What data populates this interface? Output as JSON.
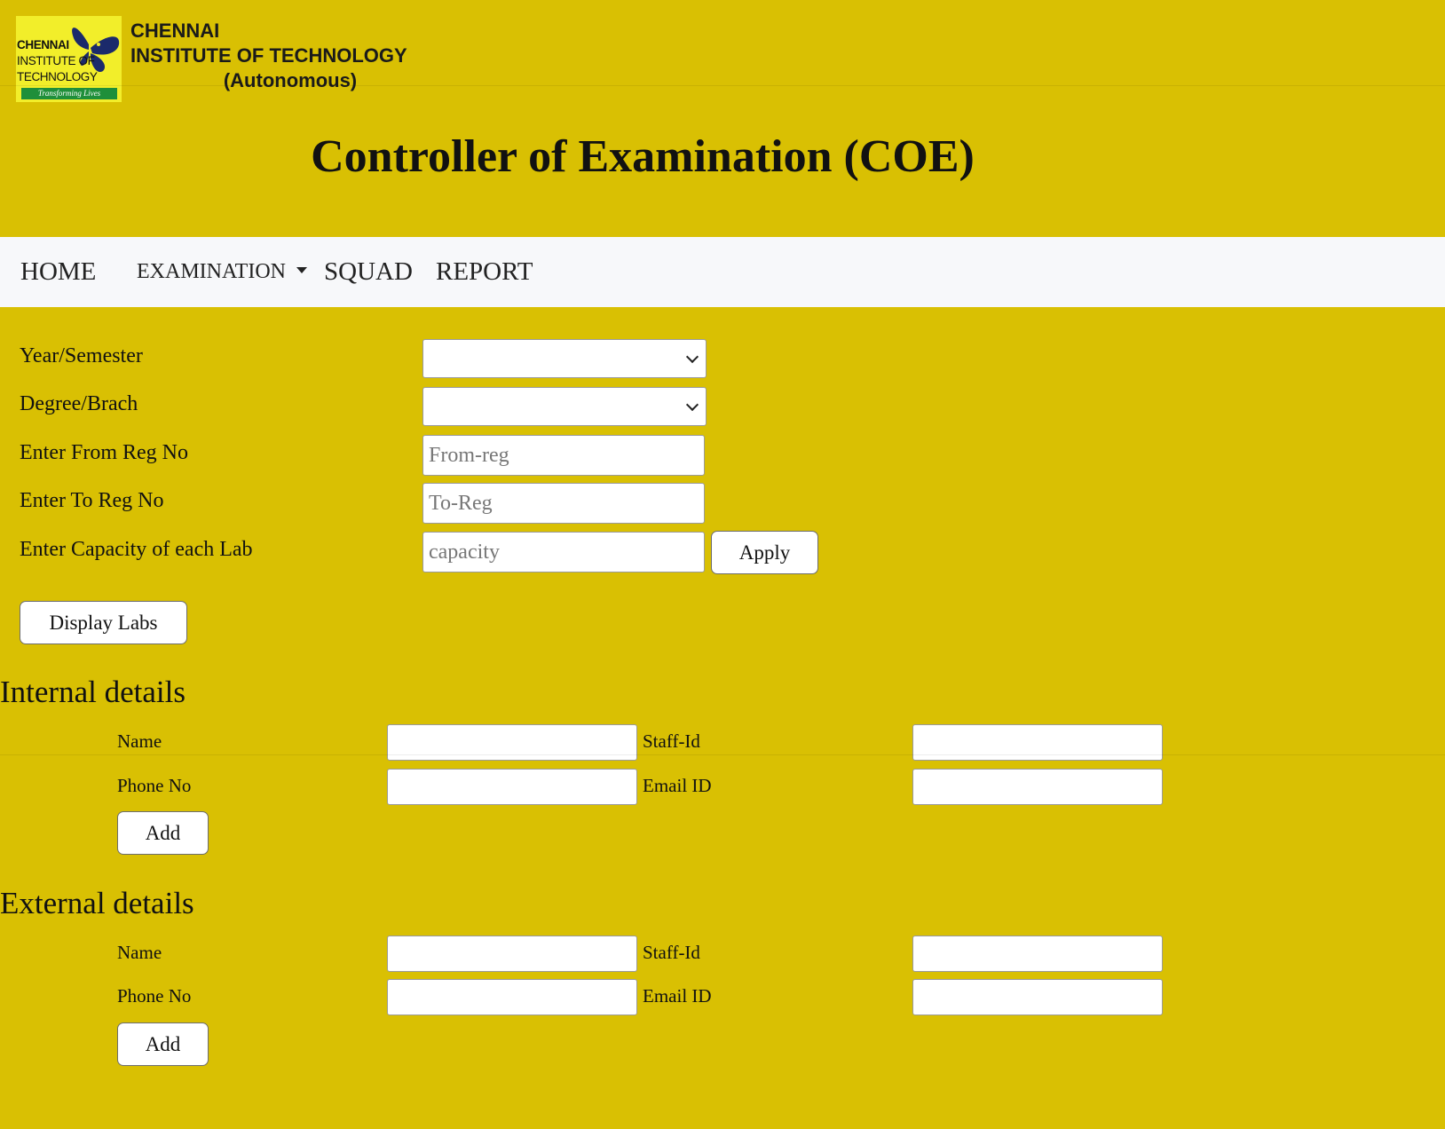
{
  "header": {
    "logo_lines": [
      "CHENNAI",
      "INSTITUTE OF",
      "TECHNOLOGY"
    ],
    "logo_tagline": "Transforming Lives",
    "institute_line1": "CHENNAI",
    "institute_line2": "INSTITUTE OF TECHNOLOGY",
    "institute_line3": "(Autonomous)",
    "title": "Controller of Examination (COE)"
  },
  "nav": {
    "items": [
      {
        "label": "HOME"
      },
      {
        "label": "EXAMINATION"
      },
      {
        "label": "SQUAD"
      },
      {
        "label": "REPORT"
      }
    ]
  },
  "form": {
    "year_label": "Year/Semester",
    "year_value": "",
    "degree_label": "Degree/Brach",
    "degree_value": "",
    "from_label": "Enter From Reg No",
    "from_placeholder": "From-reg",
    "to_label": "Enter To Reg No",
    "to_placeholder": "To-Reg",
    "capacity_label": "Enter Capacity of each Lab",
    "capacity_placeholder": "capacity",
    "apply_label": "Apply",
    "display_labs_label": "Display Labs"
  },
  "internal": {
    "heading": "Internal details",
    "name_label": "Name",
    "staff_label": "Staff-Id",
    "phone_label": "Phone No",
    "email_label": "Email ID",
    "add_label": "Add"
  },
  "external": {
    "heading": "External details",
    "name_label": "Name",
    "staff_label": "Staff-Id",
    "phone_label": "Phone No",
    "email_label": "Email ID",
    "add_label": "Add"
  },
  "colors": {
    "page_bg": "#d9c003",
    "navbar_bg": "#f7f8fa",
    "logo_bg": "#f2ee2a",
    "logo_butterfly": "#1b2a6b",
    "logo_banner": "#1f8f3a"
  }
}
